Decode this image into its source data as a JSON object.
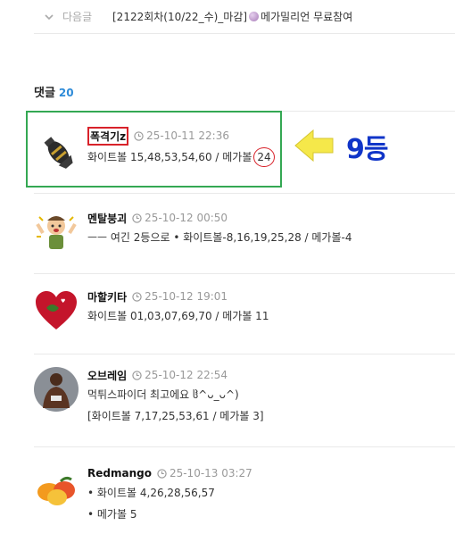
{
  "next_post": {
    "label": "다음글",
    "title_prefix": "[2122회차(10/22_수)_마감]",
    "title_suffix": "메가밀리언 무료참여"
  },
  "comments_section": {
    "title": "댓글",
    "count": "20"
  },
  "comments": [
    {
      "nick": "폭격기z",
      "time": "25-10-11 22:36",
      "text_main": "화이트볼 15,48,53,54,60 / 메가볼",
      "text_highlight": "24",
      "avatar": "bomb-icon"
    },
    {
      "nick": "멘탈붕괴",
      "time": "25-10-12 00:50",
      "text": "ㅡㅡ 여긴 2등으로 • 화이트볼-8,16,19,25,28 / 메가볼-4",
      "avatar": "mental-breakdown-avatar"
    },
    {
      "nick": "마할키타",
      "time": "25-10-12 19:01",
      "text": "화이트볼 01,03,07,69,70 / 메가볼  11",
      "avatar": "heart-avatar"
    },
    {
      "nick": "오브레임",
      "time": "25-10-12 22:54",
      "text": "먹튀스파이더 최고에요 ჱ̒^ᴗ_ᴗ^)",
      "text2": "[화이트볼 7,17,25,53,61 / 메가볼 3]",
      "avatar": "fighter-photo-avatar"
    },
    {
      "nick": "Redmango",
      "time": "25-10-13 03:27",
      "text": "• 화이트볼 4,26,28,56,57",
      "text2": "• 메가볼 5",
      "avatar": "mango-avatar"
    }
  ],
  "annotation": {
    "rank_note": "9등",
    "box_color": "#34a853",
    "mark_color": "#d8222a",
    "note_color": "#1035c8",
    "arrow_color": "#f5e84a"
  }
}
